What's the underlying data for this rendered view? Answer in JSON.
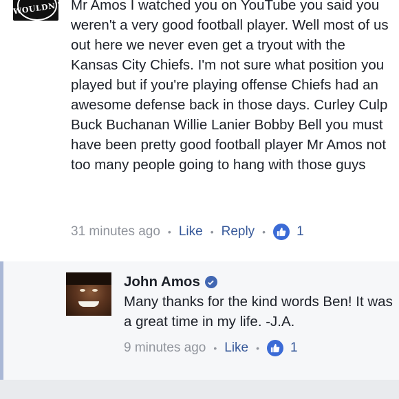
{
  "comment": {
    "avatar_text": "WOULDN'T",
    "text": "Mr Amos I watched you on YouTube you said you weren't a very good football player. Well most of us out here we never even get a tryout with the Kansas City Chiefs. I'm not sure what position you played but if you're playing offense Chiefs had an awesome defense back in those days. Curley Culp Buck Buchanan Willie Lanier Bobby Bell you must have been pretty good football player Mr Amos not too many people going to hang with those guys",
    "timestamp": "31 minutes ago",
    "like_label": "Like",
    "reply_label": "Reply",
    "like_count": "1"
  },
  "reply": {
    "name": "John Amos",
    "text": "Many thanks for the kind words Ben! It was a great time in my life. -J.A.",
    "timestamp": "9 minutes ago",
    "like_label": "Like",
    "like_count": "1"
  },
  "icons": {
    "like": "thumbs-up-icon",
    "verified": "verified-check-icon",
    "separator": "•"
  },
  "colors": {
    "link": "#365899",
    "meta": "#90949c",
    "like_badge": "#3b6bd6",
    "reply_bg": "#f6f7f9",
    "reply_bar": "#aab8d6"
  }
}
